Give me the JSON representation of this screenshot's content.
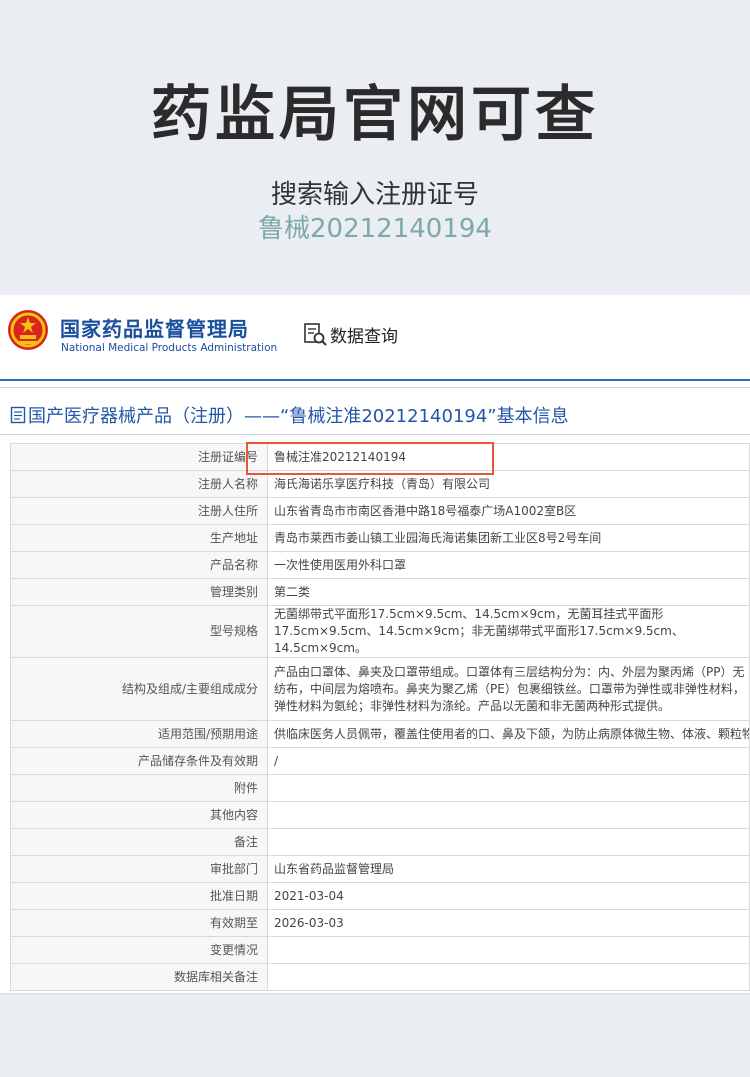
{
  "hero": {
    "title": "药监局官网可查",
    "subtitle": "搜索输入注册证号",
    "number": "鲁械20212140194"
  },
  "header": {
    "org_cn": "国家药品监督管理局",
    "org_en": "National Medical Products Administration",
    "search_label": "数据查询",
    "emblem_icon": "national-emblem-icon",
    "search_icon": "document-search-icon"
  },
  "section": {
    "title": "国产医疗器械产品（注册）——“鲁械注准20212140194”基本信息",
    "icon": "document-icon"
  },
  "table": {
    "rows": [
      {
        "label": "注册证编号",
        "value": "鲁械注准20212140194"
      },
      {
        "label": "注册人名称",
        "value": "海氏海诺乐享医疗科技（青岛）有限公司"
      },
      {
        "label": "注册人住所",
        "value": "山东省青岛市市南区香港中路18号福泰广场A1002室B区"
      },
      {
        "label": "生产地址",
        "value": "青岛市莱西市姜山镇工业园海氏海诺集团新工业区8号2号车间"
      },
      {
        "label": "产品名称",
        "value": "一次性使用医用外科口罩"
      },
      {
        "label": "管理类别",
        "value": "第二类"
      },
      {
        "label": "型号规格",
        "value": "无菌绑带式平面形17.5cm×9.5cm、14.5cm×9cm，无菌耳挂式平面形 17.5cm×9.5cm、14.5cm×9cm；非无菌绑带式平面形17.5cm×9.5cm、14.5cm×9cm。"
      },
      {
        "label": "结构及组成/主要组成成分",
        "value": "产品由口罩体、鼻夹及口罩带组成。口罩体有三层结构分为：内、外层为聚丙烯（PP）无纺布，中间层为熔喷布。鼻夹为聚乙烯（PE）包裹细铁丝。口罩带为弹性或非弹性材料，弹性材料为氨纶；非弹性材料为涤纶。产品以无菌和非无菌两种形式提供。"
      },
      {
        "label": "适用范围/预期用途",
        "value": "供临床医务人员佩带，覆盖住使用者的口、鼻及下颌，为防止病原体微生物、体液、颗粒物等的直接透过提供物理屏障。"
      },
      {
        "label": "产品储存条件及有效期",
        "value": "/"
      },
      {
        "label": "附件",
        "value": ""
      },
      {
        "label": "其他内容",
        "value": ""
      },
      {
        "label": "备注",
        "value": ""
      },
      {
        "label": "审批部门",
        "value": "山东省药品监督管理局"
      },
      {
        "label": "批准日期",
        "value": "2021-03-04"
      },
      {
        "label": "有效期至",
        "value": "2026-03-03"
      },
      {
        "label": "变更情况",
        "value": ""
      },
      {
        "label": "数据库相关备注",
        "value": ""
      }
    ]
  },
  "colors": {
    "brand_blue": "#1a4f9e",
    "highlight_red": "#e8553a",
    "hero_number": "#7fa8a8"
  }
}
